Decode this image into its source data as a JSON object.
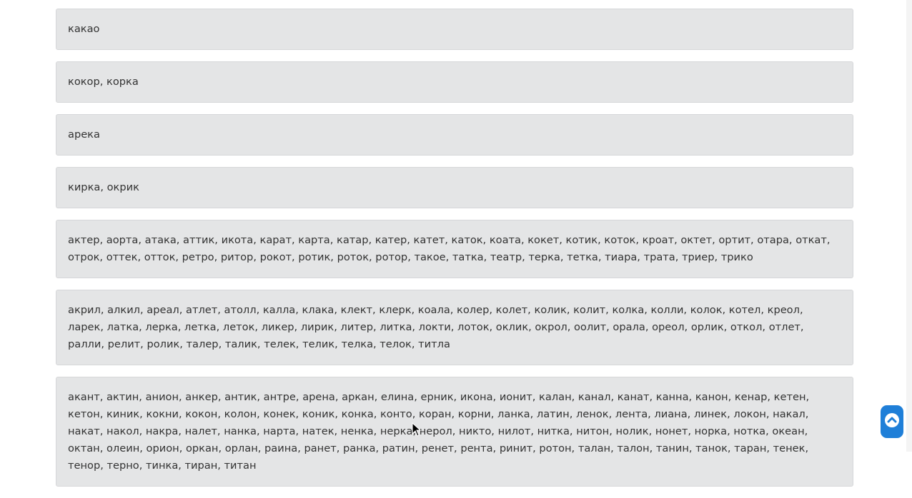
{
  "colors": {
    "card_bg": "#e4e5e6",
    "text": "#333333",
    "scroll_button": "#1f7fd8"
  },
  "icons": {
    "scroll_top": "chevron-up-circle-icon",
    "cursor": "mouse-pointer-icon"
  },
  "cards": [
    "какао",
    "кокор, корка",
    "арека",
    "кирка, окрик",
    "актер, аорта, атака, аттик, икота, карат, карта, катар, катер, катет, каток, коата, кокет, котик, коток, кроат, октет, ортит, отара, откат, отрок, оттек, отток, ретро, ритор, рокот, ротик, роток, ротор, такое, татка, театр, терка, тетка, тиара, трата, триер, трико",
    "акрил, алкил, ареал, атлет, атолл, калла, клака, клект, клерк, коала, колер, колет, колик, колит, колка, колли, колок, котел, креол, ларек, латка, лерка, летка, леток, ликер, лирик, литер, литка, локти, лоток, оклик, окрол, оолит, орала, ореол, орлик, откол, отлет, ралли, релит, ролик, талер, талик, телек, телик, телка, телок, титла",
    "акант, актин, анион, анкер, антик, антре, арена, аркан, елина, ерник, икона, ионит, калан, канал, канат, канна, канон, кенар, кетен, кетон, киник, кокни, кокон, колон, конек, коник, конка, конто, коран, корни, ланка, латин, ленок, лента, лиана, линек, локон, накал, накат, накол, накра, налет, нанка, нарта, натек, ненка, нерка, нерол, никто, нилот, нитка, нитон, нолик, нонет, норка, нотка, океан, октан, олеин, орион, оркан, орлан, раина, ранет, ранка, ратин, ренет, рента, ринит, ротон, талан, талон, танин, танок, таран, тенек, тенор, терно, тинка, тиран, титан"
  ]
}
